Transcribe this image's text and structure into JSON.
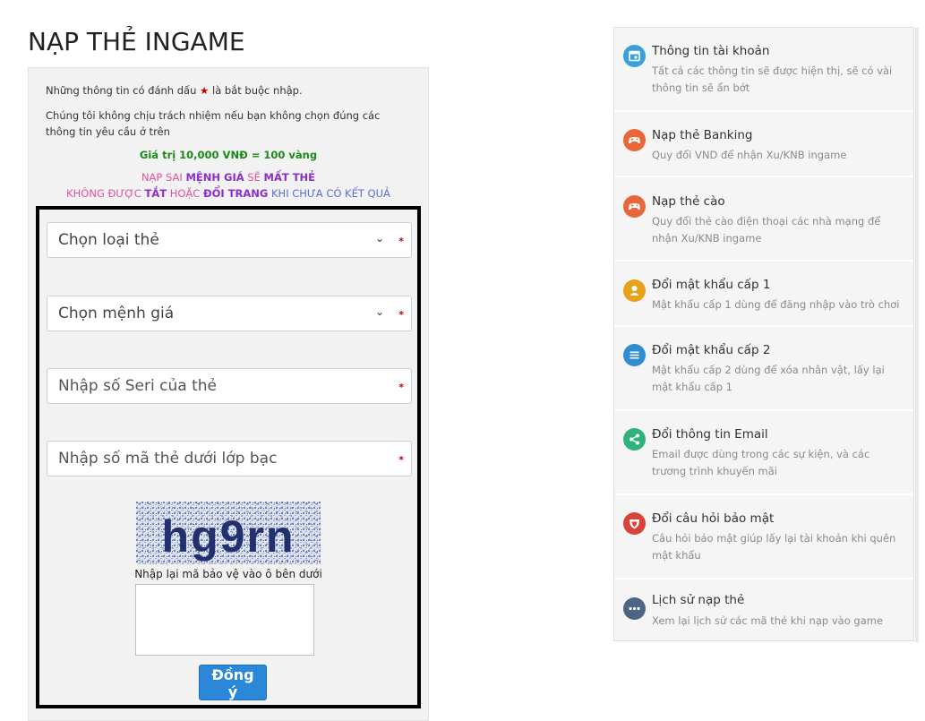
{
  "page": {
    "title": "NẠP THẺ INGAME"
  },
  "notes": {
    "required_before": "Những thông tin có đánh dấu",
    "required_star": "★",
    "required_after": "là bắt buộc nhập.",
    "disclaimer": "Chúng tôi không chịu trách nhiệm nếu bạn không chọn đúng các thông tin yêu cầu ở trên",
    "rate": "Giá trị 10,000 VNĐ = 100 vàng"
  },
  "warnings": {
    "line1": [
      "NẠP SAI",
      "MỆNH GIÁ",
      "SẼ",
      "MẤT THẺ"
    ],
    "line2": [
      "KHÔNG ĐƯỢC",
      "TẮT",
      "HOẶC",
      "ĐỔI TRANG",
      "KHI CHƯA CÓ KẾT QUẢ"
    ]
  },
  "form": {
    "card_type_placeholder": "Chọn loại thẻ",
    "card_value_placeholder": "Chọn mệnh giá",
    "serial_placeholder": "Nhập số Seri của thẻ",
    "code_placeholder": "Nhập số mã thẻ dưới lớp bạc",
    "required_mark": "*",
    "captcha_text": "hg9rn",
    "captcha_label": "Nhập lại mã bảo vệ vào ô bên dưới",
    "submit_label": "Đồng ý"
  },
  "menu": {
    "items": [
      {
        "title": "Thông tin tài khoản",
        "desc": "Tất cả các thông tin sẽ được hiện thị, sẽ có vài thông tin sẽ ẩn bớt",
        "icon": "calendar-icon",
        "color": "#3aa0d8"
      },
      {
        "title": "Nạp thẻ Banking",
        "desc": "Quy đổi VND để nhận Xu/KNB ingame",
        "icon": "gamepad-icon",
        "color": "#e8673a"
      },
      {
        "title": "Nạp thẻ cào",
        "desc": "Quy đổi thẻ cào điện thoại các nhà mạng để nhận Xu/KNB ingame",
        "icon": "gamepad-icon",
        "color": "#e8673a"
      },
      {
        "title": "Đổi mật khẩu cấp 1",
        "desc": "Mật khẩu cấp 1 dùng để đăng nhập vào trò chơi",
        "icon": "user-icon",
        "color": "#e8a21a"
      },
      {
        "title": "Đổi mật khẩu cấp 2",
        "desc": "Mật khẩu cấp 2 dùng để xóa nhân vật, lấy lại mật khẩu cấp 1",
        "icon": "list-icon",
        "color": "#2f8ed0"
      },
      {
        "title": "Đổi thông tin Email",
        "desc": "Email được dùng trong các sự kiện, và các trương trình khuyến mãi",
        "icon": "share-icon",
        "color": "#2fb37a"
      },
      {
        "title": "Đổi câu hỏi bảo mật",
        "desc": "Câu hỏi bảo mật giúp lấy lại tài khoản khi quên mật khẩu",
        "icon": "shield-icon",
        "color": "#d9443a"
      },
      {
        "title": "Lịch sử nạp thẻ",
        "desc": "Xem lại lịch sử các mã thẻ khi nạp vào game",
        "icon": "more-icon",
        "color": "#4d6584"
      }
    ]
  }
}
